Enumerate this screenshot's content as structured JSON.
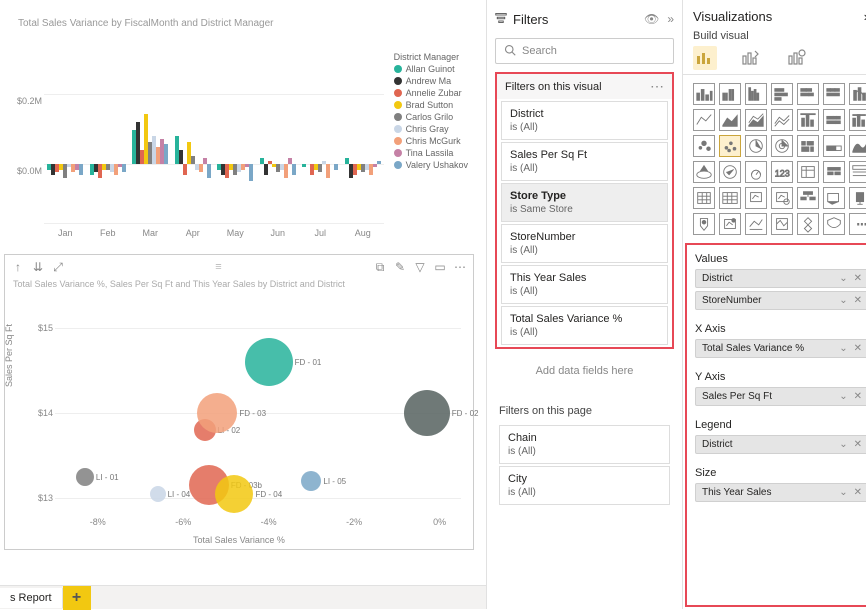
{
  "chart_data": [
    {
      "type": "bar",
      "title": "Total Sales Variance by FiscalMonth and District Manager",
      "ylabel": "",
      "yticks": [
        "$0.2M",
        "$0.0M"
      ],
      "categories": [
        "Jan",
        "Feb",
        "Mar",
        "Apr",
        "May",
        "Jun",
        "Jul",
        "Aug"
      ],
      "legend_title": "District Manager",
      "series": [
        {
          "name": "Allan Guinot",
          "color": "#27b39b",
          "values": [
            -0.02,
            -0.04,
            0.12,
            0.1,
            -0.02,
            0.02,
            -0.01,
            0.02
          ]
        },
        {
          "name": "Andrew Ma",
          "color": "#333333",
          "values": [
            -0.04,
            -0.03,
            0.15,
            0.05,
            -0.04,
            -0.04,
            0.0,
            -0.05
          ]
        },
        {
          "name": "Annelie Zubar",
          "color": "#e06651",
          "values": [
            -0.03,
            -0.05,
            0.05,
            -0.04,
            -0.05,
            0.01,
            -0.04,
            -0.04
          ]
        },
        {
          "name": "Brad Sutton",
          "color": "#f2c811",
          "values": [
            -0.02,
            -0.02,
            0.18,
            0.08,
            -0.02,
            -0.01,
            -0.02,
            -0.02
          ]
        },
        {
          "name": "Carlos Grilo",
          "color": "#808080",
          "values": [
            -0.05,
            -0.02,
            0.08,
            0.03,
            -0.04,
            -0.03,
            -0.03,
            -0.03
          ]
        },
        {
          "name": "Chris Gray",
          "color": "#c9d6e6",
          "values": [
            -0.01,
            -0.03,
            0.1,
            -0.02,
            -0.03,
            -0.02,
            0.01,
            -0.02
          ]
        },
        {
          "name": "Chris McGurk",
          "color": "#f2a07a",
          "values": [
            -0.03,
            -0.04,
            0.06,
            -0.03,
            -0.02,
            -0.05,
            -0.05,
            -0.04
          ]
        },
        {
          "name": "Tina Lassila",
          "color": "#c581a6",
          "values": [
            -0.02,
            -0.01,
            0.09,
            0.02,
            -0.01,
            0.02,
            0.0,
            -0.01
          ]
        },
        {
          "name": "Valery Ushakov",
          "color": "#7aa7c7",
          "values": [
            -0.04,
            -0.03,
            0.07,
            -0.05,
            -0.06,
            -0.04,
            -0.02,
            0.01
          ]
        }
      ],
      "ylim": [
        -0.1,
        0.25
      ]
    },
    {
      "type": "scatter",
      "title": "Total Sales Variance %, Sales Per Sq Ft and This Year Sales by District and District",
      "xlabel": "Total Sales Variance %",
      "ylabel": "Sales Per Sq Ft",
      "xticks": [
        "-8%",
        "-6%",
        "-4%",
        "-2%",
        "0%"
      ],
      "yticks": [
        "$13",
        "$14",
        "$15"
      ],
      "xlim": [
        -9,
        0.5
      ],
      "ylim": [
        12.8,
        15.3
      ],
      "points": [
        {
          "label": "FD - 01",
          "x": -4.0,
          "y": 14.6,
          "size": 48,
          "color": "#27b39b"
        },
        {
          "label": "FD - 02",
          "x": -0.3,
          "y": 14.0,
          "size": 46,
          "color": "#56615f"
        },
        {
          "label": "LI - 02",
          "x": -5.5,
          "y": 13.8,
          "size": 22,
          "color": "#e06651"
        },
        {
          "label": "FD - 03",
          "x": -5.2,
          "y": 14.0,
          "size": 40,
          "color": "#f2a07a"
        },
        {
          "label": "LI - 01",
          "x": -8.3,
          "y": 13.25,
          "size": 18,
          "color": "#808080"
        },
        {
          "label": "LI - 04",
          "x": -6.6,
          "y": 13.05,
          "size": 16,
          "color": "#c9d6e6"
        },
        {
          "label": "FD - 03b",
          "x": -5.4,
          "y": 13.15,
          "size": 40,
          "color": "#e06651"
        },
        {
          "label": "FD - 04",
          "x": -4.8,
          "y": 13.05,
          "size": 38,
          "color": "#f2c811"
        },
        {
          "label": "LI - 05",
          "x": -3.0,
          "y": 13.2,
          "size": 20,
          "color": "#7aa7c7"
        }
      ]
    }
  ],
  "filters": {
    "title": "Filters",
    "search_placeholder": "Search",
    "visual_section": "Filters on this visual",
    "add_prompt": "Add data fields here",
    "page_section": "Filters on this page",
    "visual_filters": [
      {
        "name": "District",
        "value": "is (All)",
        "selected": false
      },
      {
        "name": "Sales Per Sq Ft",
        "value": "is (All)",
        "selected": false
      },
      {
        "name": "Store Type",
        "value": "is Same Store",
        "selected": true
      },
      {
        "name": "StoreNumber",
        "value": "is (All)",
        "selected": false
      },
      {
        "name": "This Year Sales",
        "value": "is (All)",
        "selected": false
      },
      {
        "name": "Total Sales Variance %",
        "value": "is (All)",
        "selected": false
      }
    ],
    "page_filters": [
      {
        "name": "Chain",
        "value": "is (All)"
      },
      {
        "name": "City",
        "value": "is (All)"
      }
    ]
  },
  "viz": {
    "title": "Visualizations",
    "sub": "Build visual",
    "wells": {
      "values_title": "Values",
      "values": [
        "District",
        "StoreNumber"
      ],
      "xaxis_title": "X Axis",
      "xaxis": [
        "Total Sales Variance %"
      ],
      "yaxis_title": "Y Axis",
      "yaxis": [
        "Sales Per Sq Ft"
      ],
      "legend_title": "Legend",
      "legend": [
        "District"
      ],
      "size_title": "Size",
      "size": [
        "This Year Sales"
      ]
    }
  },
  "page_tab": "s Report"
}
